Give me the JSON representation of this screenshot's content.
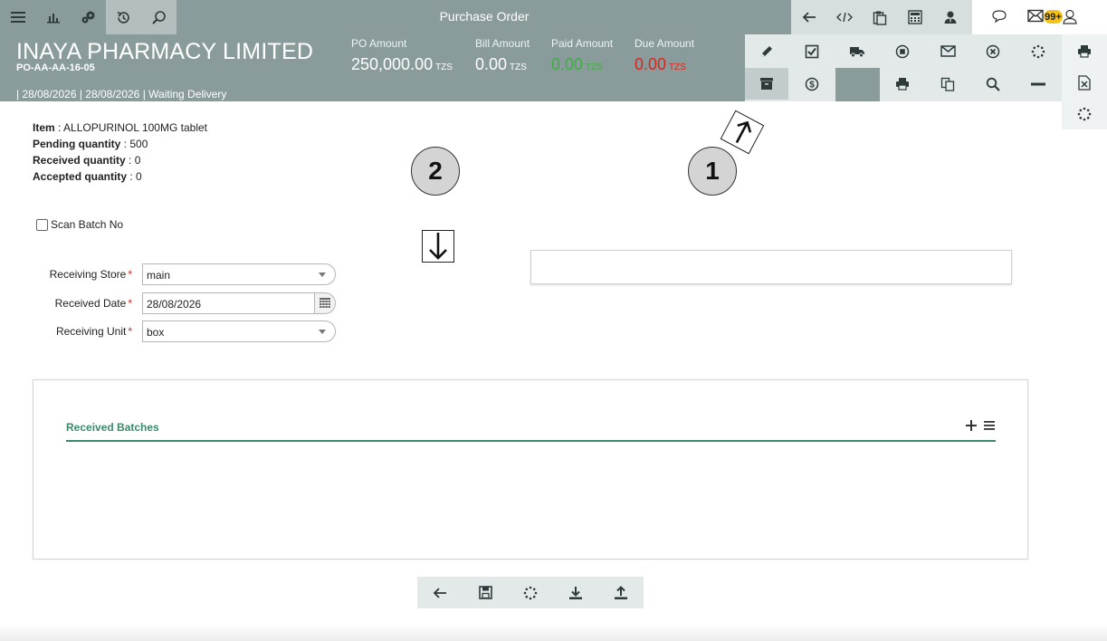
{
  "topbar": {
    "title": "Purchase Order",
    "left_icons": [
      "menu-icon",
      "chart-icon",
      "gears-icon",
      "history-icon",
      "search-icon"
    ],
    "right_icons": [
      "back-arrow-icon",
      "code-icon",
      "clipboard-icon",
      "calculator-icon",
      "user-tie-icon"
    ],
    "notification_badge": "99+",
    "far_icons": [
      "chat-icon",
      "mail-icon",
      "user-icon"
    ]
  },
  "header": {
    "company": "INAYA PHARMACY LIMITED",
    "po_number": "PO-AA-AA-16-05",
    "meta": "| 28/08/2026 | 28/08/2026 | Waiting Delivery",
    "amounts": {
      "po": {
        "label": "PO Amount",
        "value": "250,000.00",
        "currency": "TZS"
      },
      "bill": {
        "label": "Bill Amount",
        "value": "0.00",
        "currency": "TZS"
      },
      "paid": {
        "label": "Paid Amount",
        "value": "0.00",
        "currency": "TZS"
      },
      "due": {
        "label": "Due Amount",
        "value": "0.00",
        "currency": "TZS"
      }
    },
    "colors": {
      "paid": "#3fae3f",
      "due": "#d9261c",
      "header_bg": "#8a9b9b"
    }
  },
  "actions": {
    "row1": [
      "edit-icon",
      "check-square-icon",
      "truck-icon",
      "stop-circle-icon",
      "envelope-icon",
      "cancel-circle-icon",
      "spinner-icon"
    ],
    "row2": [
      "archive-icon",
      "dollar-circle-icon",
      "print-icon",
      "copy-icon",
      "search-icon",
      "minus-icon"
    ],
    "right_col": [
      "print-icon",
      "excel-icon",
      "spinner-icon"
    ]
  },
  "item": {
    "item_label": "Item",
    "item_value": "ALLOPURINOL 100MG tablet",
    "pending_label": "Pending quantity",
    "pending_value": "500",
    "received_label": "Received quantity",
    "received_value": "0",
    "accepted_label": "Accepted quantity",
    "accepted_value": "0"
  },
  "scan_batch": {
    "label": "Scan Batch No",
    "checked": false
  },
  "form": {
    "store_label": "Receiving Store",
    "store_value": "main",
    "date_label": "Received Date",
    "date_value": "28/08/2026",
    "unit_label": "Receiving Unit",
    "unit_value": "box",
    "required_mark": "*"
  },
  "batches": {
    "title": "Received Batches",
    "accent": "#3c8a6a"
  },
  "bottom_toolbar": [
    "back-arrow-icon",
    "save-icon",
    "spinner-icon",
    "download-icon",
    "upload-icon"
  ],
  "annotations": {
    "marker_1": "1",
    "marker_2": "2"
  }
}
